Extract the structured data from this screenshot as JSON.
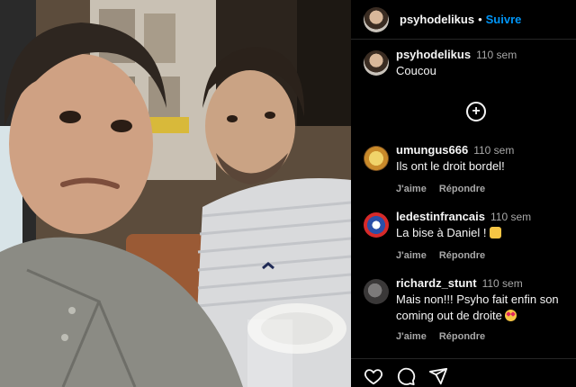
{
  "post": {
    "author": "psyhodelikus",
    "separator": "•",
    "follow_label": "Suivre"
  },
  "caption": {
    "username": "psyhodelikus",
    "time": "110 sem",
    "text": "Coucou"
  },
  "load_more_icon": "plus-circle-icon",
  "comments": [
    {
      "username": "umungus666",
      "time": "110 sem",
      "text": "Ils ont le droit bordel!",
      "like_label": "J'aime",
      "reply_label": "Répondre"
    },
    {
      "username": "ledestinfrancais",
      "time": "110 sem",
      "text": "La bise à Daniel ! ",
      "like_label": "J'aime",
      "reply_label": "Répondre"
    },
    {
      "username": "richardz_stunt",
      "time": "110 sem",
      "text": "Mais non!!! Psyho fait enfin son coming out de droite ",
      "like_label": "J'aime",
      "reply_label": "Répondre"
    }
  ],
  "actions": {
    "like_icon": "heart-icon",
    "comment_icon": "comment-icon",
    "share_icon": "send-icon"
  },
  "colors": {
    "follow": "#0095f6",
    "background": "#000000",
    "muted": "#a8a8a8"
  }
}
